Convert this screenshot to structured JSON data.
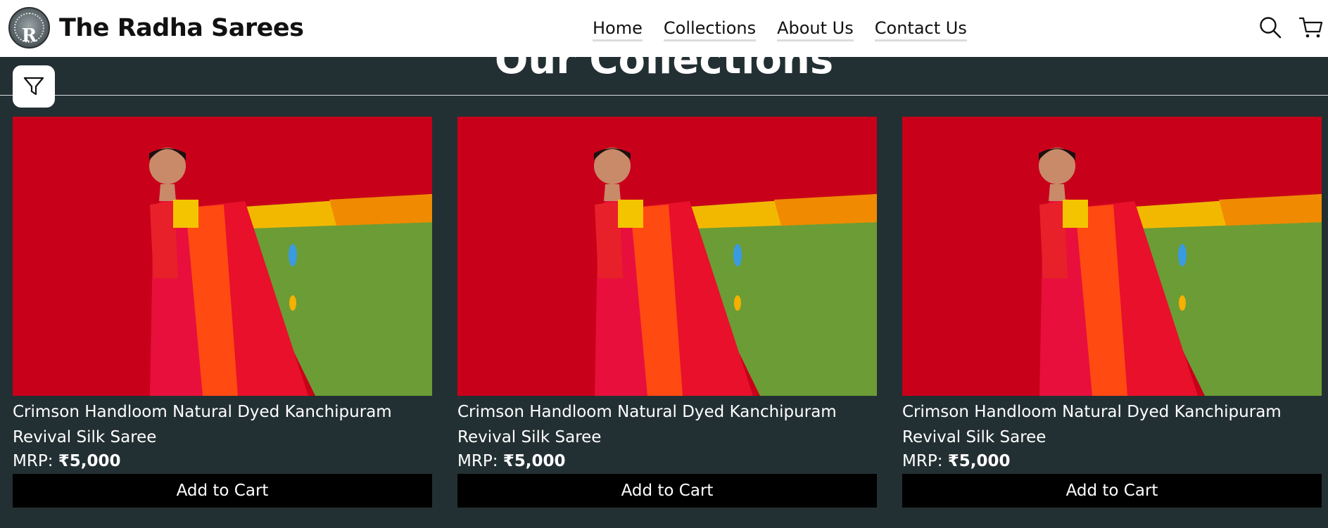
{
  "header": {
    "logo_letter": "R",
    "brand": "The Radha Sarees",
    "nav": [
      "Home",
      "Collections",
      "About Us",
      "Contact Us"
    ]
  },
  "section": {
    "title": "Our Collections"
  },
  "products": [
    {
      "name": "Crimson Handloom Natural Dyed Kanchipuram Revival Silk Saree",
      "price_label": "MRP:",
      "price": "₹5,000",
      "button": "Add to Cart"
    },
    {
      "name": "Crimson Handloom Natural Dyed Kanchipuram Revival Silk Saree",
      "price_label": "MRP:",
      "price": "₹5,000",
      "button": "Add to Cart"
    },
    {
      "name": "Crimson Handloom Natural Dyed Kanchipuram Revival Silk Saree",
      "price_label": "MRP:",
      "price": "₹5,000",
      "button": "Add to Cart"
    }
  ],
  "colors": {
    "page_bg": "#233033",
    "header_bg": "#ffffff",
    "button_bg": "#000000",
    "photo_bg": "#c8001a"
  },
  "icons": [
    "filter-icon",
    "search-icon",
    "cart-icon"
  ]
}
